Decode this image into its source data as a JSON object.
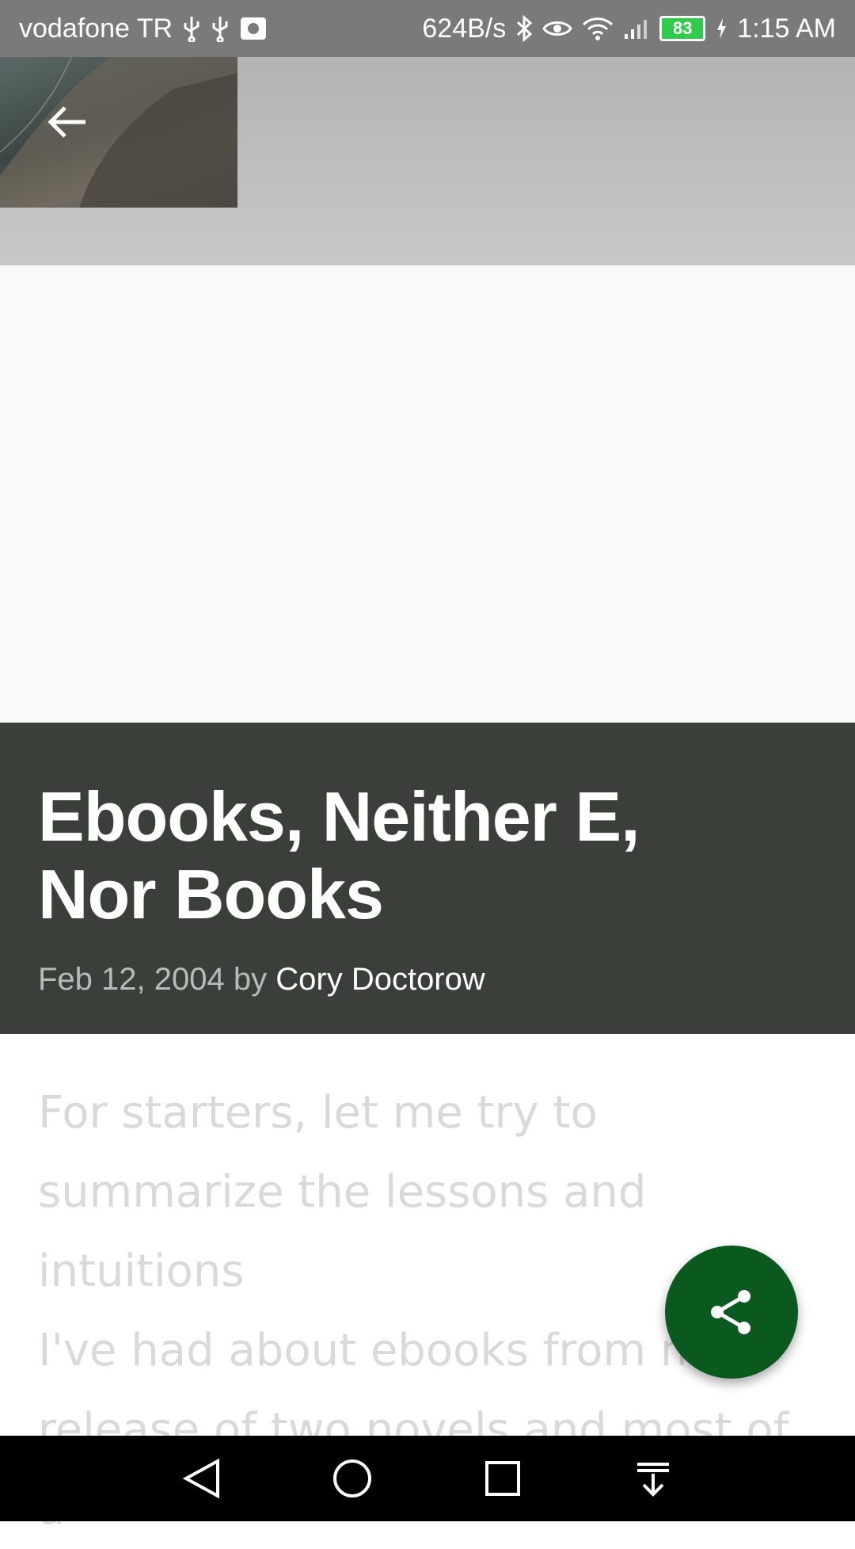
{
  "status_bar": {
    "carrier": "vodafone TR",
    "net_speed": "624B/s",
    "battery_level": "83",
    "time": "1:15 AM",
    "icons": [
      "usb-icon",
      "usb-icon",
      "screenshot-icon",
      "bluetooth-icon",
      "eye-icon",
      "wifi-icon",
      "signal-icon",
      "battery-icon",
      "charging-icon"
    ]
  },
  "app_bar": {
    "back_icon": "arrow-left-icon"
  },
  "article": {
    "title": "Ebooks, Neither E, Nor Books",
    "date": "Feb 12, 2004",
    "by": "by",
    "author": "Cory Doctorow",
    "paragraphs": [
      "For starters, let me try to summarize the lessons and intuitions",
      "I've had about ebooks from my release of two novels and most of a"
    ]
  },
  "fab": {
    "icon": "share-icon"
  },
  "nav_bar": {
    "icons": [
      "back-triangle-icon",
      "home-circle-icon",
      "recents-square-icon",
      "notification-pull-icon"
    ]
  },
  "colors": {
    "title_panel": "#3a3f3a",
    "fab": "#0a5a1f",
    "status_bar": "#7a7a7a"
  }
}
